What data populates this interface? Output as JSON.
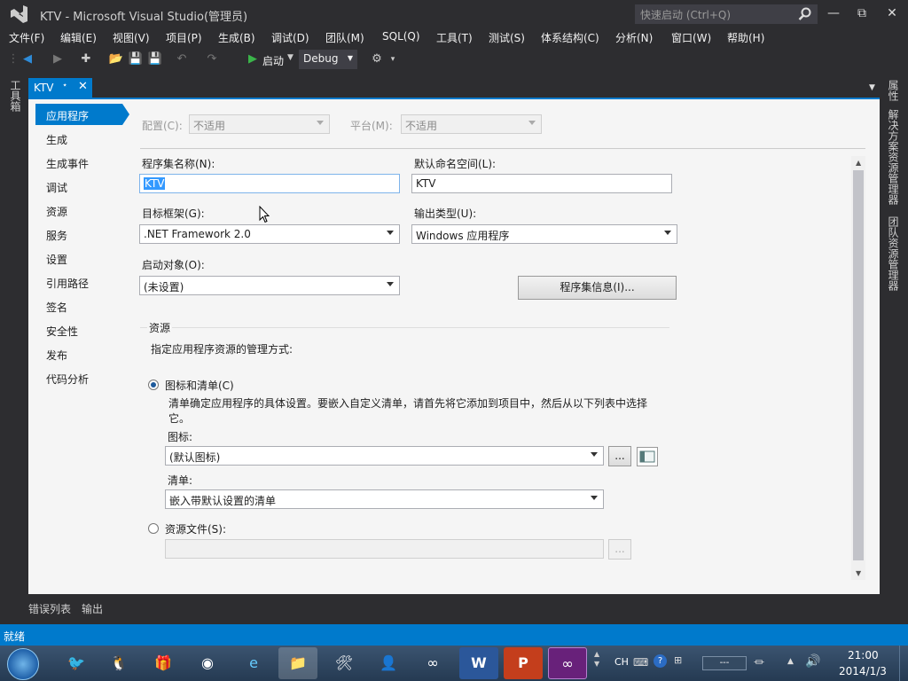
{
  "window": {
    "title": "KTV - Microsoft Visual Studio(管理员)",
    "quick_launch_placeholder": "快速启动 (Ctrl+Q)"
  },
  "menu": [
    "文件(F)",
    "编辑(E)",
    "视图(V)",
    "项目(P)",
    "生成(B)",
    "调试(D)",
    "团队(M)",
    "SQL(Q)",
    "工具(T)",
    "测试(S)",
    "体系结构(C)",
    "分析(N)",
    "窗口(W)",
    "帮助(H)"
  ],
  "toolbar": {
    "start_label": "启动",
    "config_value": "Debug"
  },
  "document_tab": {
    "label": "KTV"
  },
  "left_panel": {
    "label": "工具箱"
  },
  "right_panels": [
    "属性",
    "解决方案资源管理器",
    "团队资源管理器"
  ],
  "nav": [
    "应用程序",
    "生成",
    "生成事件",
    "调试",
    "资源",
    "服务",
    "设置",
    "引用路径",
    "签名",
    "安全性",
    "发布",
    "代码分析"
  ],
  "config_bar": {
    "config_label": "配置(C):",
    "config_value": "不适用",
    "platform_label": "平台(M):",
    "platform_value": "不适用"
  },
  "form": {
    "assembly_name_label": "程序集名称(N):",
    "assembly_name_value": "KTV",
    "namespace_label": "默认命名空间(L):",
    "namespace_value": "KTV",
    "target_framework_label": "目标框架(G):",
    "target_framework_value": ".NET Framework 2.0",
    "output_type_label": "输出类型(U):",
    "output_type_value": "Windows 应用程序",
    "startup_object_label": "启动对象(O):",
    "startup_object_value": "(未设置)",
    "assembly_info_button": "程序集信息(I)..."
  },
  "resources": {
    "group_title": "资源",
    "description": "指定应用程序资源的管理方式:",
    "option_icon_manifest": "图标和清单(C)",
    "option_icon_manifest_desc_1": "清单确定应用程序的具体设置。要嵌入自定义清单，请首先将它添加到项目中，然后从以下列表中选择",
    "option_icon_manifest_desc_2": "它。",
    "icon_label": "图标:",
    "icon_value": "(默认图标)",
    "browse_label": "...",
    "manifest_label": "清单:",
    "manifest_value": "嵌入带默认设置的清单",
    "option_resource_file": "资源文件(S):",
    "resource_file_value": "",
    "resource_browse_label": "..."
  },
  "bottom_tabs": [
    "错误列表",
    "输出"
  ],
  "status": {
    "text": "就绪"
  },
  "taskbar": {
    "ime": "CH",
    "time": "21:00",
    "date": "2014/1/3"
  },
  "colors": {
    "accent": "#007acc",
    "chrome": "#2d2d30",
    "content": "#f5f5f5"
  }
}
